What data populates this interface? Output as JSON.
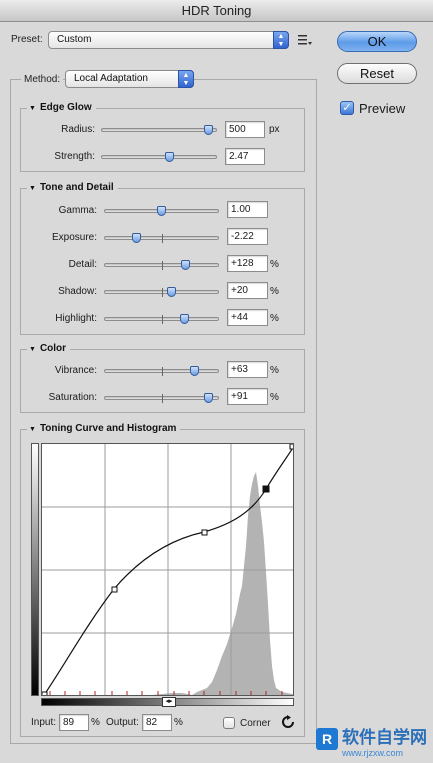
{
  "window": {
    "title": "HDR Toning"
  },
  "preset": {
    "label": "Preset:",
    "value": "Custom"
  },
  "buttons": {
    "ok": "OK",
    "cancel": "Reset"
  },
  "preview": {
    "label": "Preview",
    "checked": true
  },
  "method": {
    "label": "Method:",
    "value": "Local Adaptation"
  },
  "edge_glow": {
    "title": "Edge Glow",
    "radius": {
      "label": "Radius:",
      "value": "500",
      "unit": "px",
      "level": 0.97
    },
    "strength": {
      "label": "Strength:",
      "value": "2.47",
      "level": 0.6
    }
  },
  "tone_detail": {
    "title": "Tone and Detail",
    "gamma": {
      "label": "Gamma:",
      "value": "1.00",
      "level": 0.5
    },
    "exposure": {
      "label": "Exposure:",
      "value": "-2.22",
      "level": 0.26
    },
    "detail": {
      "label": "Detail:",
      "value": "+128",
      "unit": "%",
      "level": 0.73
    },
    "shadow": {
      "label": "Shadow:",
      "value": "+20",
      "unit": "%",
      "level": 0.6
    },
    "highlight": {
      "label": "Highlight:",
      "value": "+44",
      "unit": "%",
      "level": 0.72
    }
  },
  "color": {
    "title": "Color",
    "vibrance": {
      "label": "Vibrance:",
      "value": "+63",
      "unit": "%",
      "level": 0.82
    },
    "saturation": {
      "label": "Saturation:",
      "value": "+91",
      "unit": "%",
      "level": 0.95
    }
  },
  "curve": {
    "title": "Toning Curve and Histogram",
    "input_label": "Input:",
    "input_value": "89",
    "input_unit": "%",
    "output_label": "Output:",
    "output_value": "82",
    "output_unit": "%",
    "corner_label": "Corner"
  },
  "watermark": {
    "text": "软件自学网",
    "url": "www.rjzxw.com"
  },
  "colors": {
    "accent": "#3d78d8",
    "graph_bg": "#ffffff",
    "histogram": "#b3b3b3"
  },
  "icons": {
    "preset_menu": "list-menu-icon",
    "reset": "circular-arrow-icon",
    "group_toggle": "triangle-down-icon"
  }
}
